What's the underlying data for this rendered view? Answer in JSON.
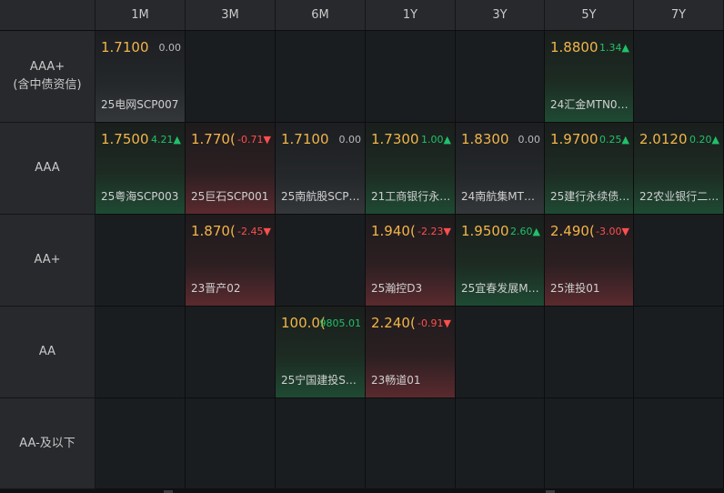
{
  "columns": [
    "1M",
    "3M",
    "6M",
    "1Y",
    "3Y",
    "5Y",
    "7Y"
  ],
  "rows": [
    {
      "label_line1": "AAA+",
      "label_line2": "(含中债资信)"
    },
    {
      "label_line1": "AAA",
      "label_line2": ""
    },
    {
      "label_line1": "AA+",
      "label_line2": ""
    },
    {
      "label_line1": "AA",
      "label_line2": ""
    },
    {
      "label_line1": "AA-及以下",
      "label_line2": ""
    }
  ],
  "cells": {
    "r0c0": {
      "price": "1.7100",
      "change": "0.00",
      "arrow": "",
      "dir": "flat",
      "name": "25电网SCP007",
      "tone": "neutral"
    },
    "r0c5": {
      "price": "1.8800",
      "change": "1.34",
      "arrow": "▲",
      "dir": "up",
      "name": "24汇金MTN0…",
      "tone": "up"
    },
    "r1c0": {
      "price": "1.7500",
      "change": "4.21",
      "arrow": "▲",
      "dir": "up",
      "name": "25粤海SCP003",
      "tone": "up"
    },
    "r1c1": {
      "price": "1.770(",
      "change": "-0.71",
      "arrow": "▼",
      "dir": "down",
      "name": "25巨石SCP001",
      "tone": "down"
    },
    "r1c2": {
      "price": "1.7100",
      "change": "0.00",
      "arrow": "",
      "dir": "flat",
      "name": "25南航股SCP…",
      "tone": "neutral"
    },
    "r1c3": {
      "price": "1.7300",
      "change": "1.00",
      "arrow": "▲",
      "dir": "up",
      "name": "21工商银行永…",
      "tone": "up"
    },
    "r1c4": {
      "price": "1.8300",
      "change": "0.00",
      "arrow": "",
      "dir": "flat",
      "name": "24南航集MT…",
      "tone": "neutral"
    },
    "r1c5": {
      "price": "1.9700",
      "change": "0.25",
      "arrow": "▲",
      "dir": "up",
      "name": "25建行永续债…",
      "tone": "up"
    },
    "r1c6": {
      "price": "2.0120",
      "change": "0.20",
      "arrow": "▲",
      "dir": "up",
      "name": "22农业银行二…",
      "tone": "up"
    },
    "r2c1": {
      "price": "1.870(",
      "change": "-2.45",
      "arrow": "▼",
      "dir": "down",
      "name": "23晋产02",
      "tone": "down"
    },
    "r2c3": {
      "price": "1.940(",
      "change": "-2.23",
      "arrow": "▼",
      "dir": "down",
      "name": "25瀚控D3",
      "tone": "down"
    },
    "r2c4": {
      "price": "1.9500",
      "change": "2.60",
      "arrow": "▲",
      "dir": "up",
      "name": "25宜春发展M…",
      "tone": "up"
    },
    "r2c5": {
      "price": "2.490(",
      "change": "-3.00",
      "arrow": "▼",
      "dir": "down",
      "name": "25淮投01",
      "tone": "down"
    },
    "r3c2": {
      "price": "100.0(",
      "change": "9805.01",
      "arrow": "",
      "dir": "up",
      "name": "25宁国建投S…",
      "tone": "up"
    },
    "r3c3": {
      "price": "2.240(",
      "change": "-0.91",
      "arrow": "▼",
      "dir": "down",
      "name": "23畅道01",
      "tone": "down"
    }
  }
}
